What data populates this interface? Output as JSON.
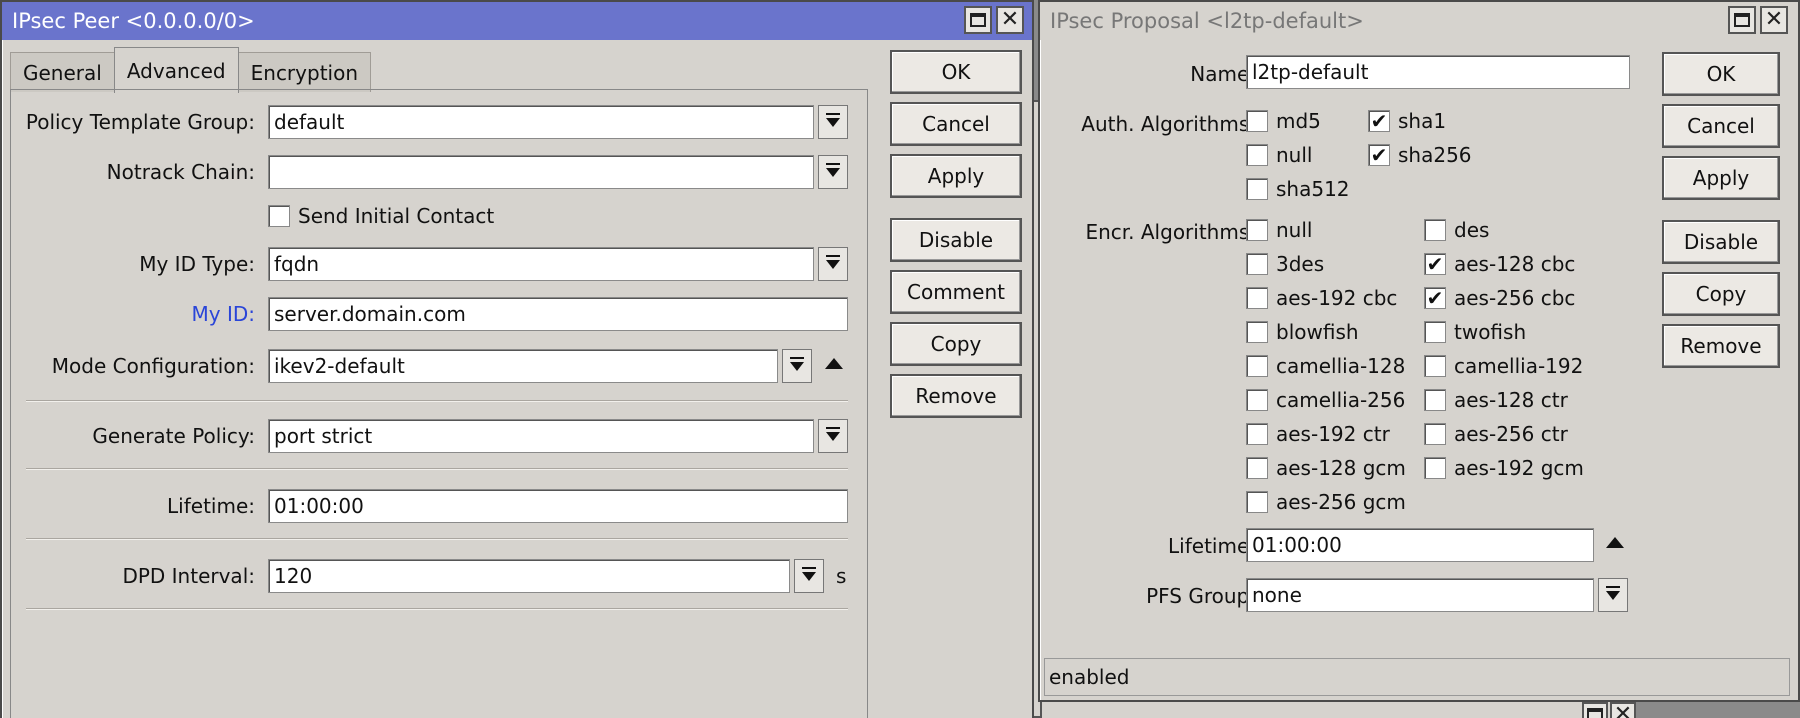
{
  "peer": {
    "title": "IPsec Peer <0.0.0.0/0>",
    "tabs": [
      {
        "label": "General"
      },
      {
        "label": "Advanced"
      },
      {
        "label": "Encryption"
      }
    ],
    "fields": {
      "policy_template_group": {
        "label": "Policy Template Group:",
        "value": "default"
      },
      "notrack_chain": {
        "label": "Notrack Chain:",
        "value": ""
      },
      "send_initial_contact": {
        "label": "Send Initial Contact",
        "checked": false
      },
      "my_id_type": {
        "label": "My ID Type:",
        "value": "fqdn"
      },
      "my_id": {
        "label": "My ID:",
        "value": "server.domain.com"
      },
      "mode_configuration": {
        "label": "Mode Configuration:",
        "value": "ikev2-default"
      },
      "generate_policy": {
        "label": "Generate Policy:",
        "value": "port strict"
      },
      "lifetime": {
        "label": "Lifetime:",
        "value": "01:00:00"
      },
      "dpd_interval": {
        "label": "DPD Interval:",
        "value": "120",
        "unit": "s"
      }
    },
    "buttons": [
      "OK",
      "Cancel",
      "Apply",
      "Disable",
      "Comment",
      "Copy",
      "Remove"
    ]
  },
  "proposal": {
    "title": "IPsec Proposal <l2tp-default>",
    "name": {
      "label": "Name:",
      "value": "l2tp-default"
    },
    "auth_label": "Auth. Algorithms:",
    "auth_algorithms": [
      {
        "label": "md5",
        "checked": false
      },
      {
        "label": "sha1",
        "checked": true
      },
      {
        "label": "null",
        "checked": false
      },
      {
        "label": "sha256",
        "checked": true
      },
      {
        "label": "sha512",
        "checked": false
      }
    ],
    "encr_label": "Encr. Algorithms:",
    "encr_algorithms": [
      {
        "label": "null",
        "checked": false
      },
      {
        "label": "des",
        "checked": false
      },
      {
        "label": "3des",
        "checked": false
      },
      {
        "label": "aes-128 cbc",
        "checked": true
      },
      {
        "label": "aes-192 cbc",
        "checked": false
      },
      {
        "label": "aes-256 cbc",
        "checked": true
      },
      {
        "label": "blowfish",
        "checked": false
      },
      {
        "label": "twofish",
        "checked": false
      },
      {
        "label": "camellia-128",
        "checked": false
      },
      {
        "label": "camellia-192",
        "checked": false
      },
      {
        "label": "camellia-256",
        "checked": false
      },
      {
        "label": "aes-128 ctr",
        "checked": false
      },
      {
        "label": "aes-192 ctr",
        "checked": false
      },
      {
        "label": "aes-256 ctr",
        "checked": false
      },
      {
        "label": "aes-128 gcm",
        "checked": false
      },
      {
        "label": "aes-192 gcm",
        "checked": false
      },
      {
        "label": "aes-256 gcm",
        "checked": false
      }
    ],
    "lifetime": {
      "label": "Lifetime:",
      "value": "01:00:00"
    },
    "pfs_group": {
      "label": "PFS Group:",
      "value": "none"
    },
    "status": "enabled",
    "buttons": [
      "OK",
      "Cancel",
      "Apply",
      "Disable",
      "Copy",
      "Remove"
    ]
  },
  "colors": {
    "active_title": "#6a74cc",
    "window_bg": "#d6d3ce",
    "link_label": "#2a45d8"
  }
}
